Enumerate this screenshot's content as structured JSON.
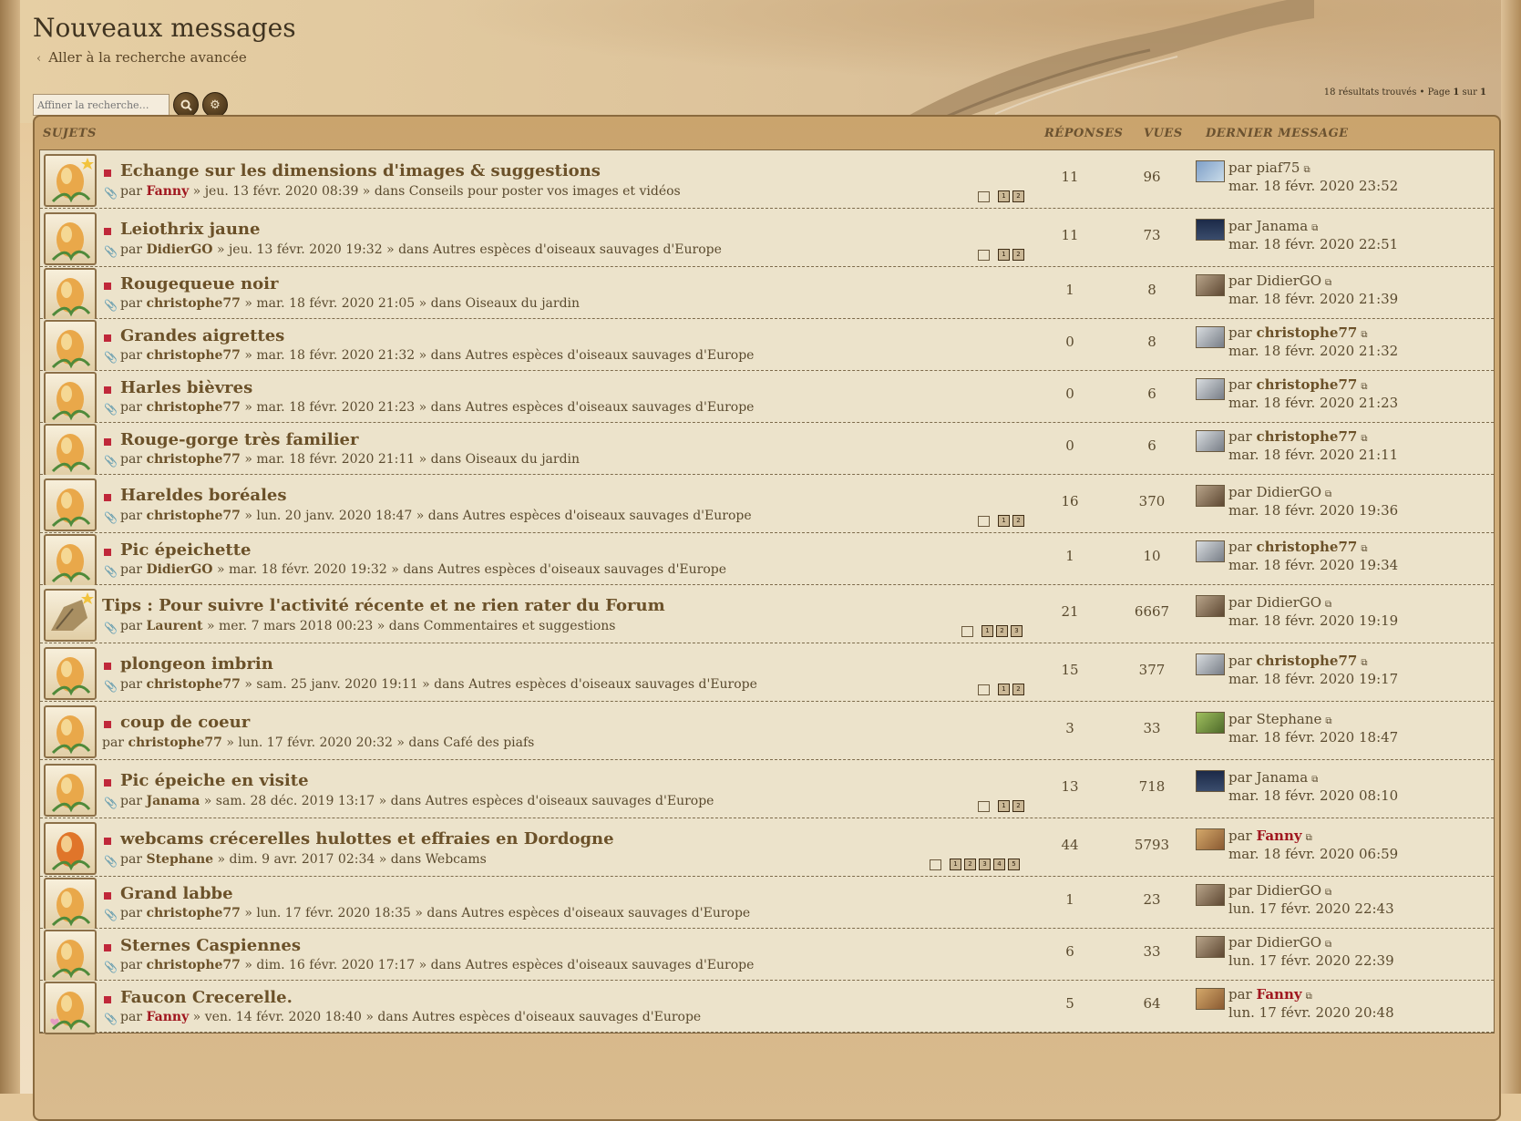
{
  "page": {
    "title": "Nouveaux messages",
    "advanced_search": "Aller à la recherche avancée",
    "search_placeholder": "Affiner la recherche…",
    "results_prefix": "18 résultats trouvés • Page ",
    "results_page": "1",
    "results_mid": " sur ",
    "results_total": "1"
  },
  "columns": {
    "subjects": "SUJETS",
    "replies": "RÉPONSES",
    "views": "VUES",
    "last_post": "DERNIER MESSAGE"
  },
  "colors": {
    "accent": "#6b5129",
    "author_red": "#a0161e",
    "new_marker": "#c0283a"
  },
  "topics": [
    {
      "title": "Echange sur les dimensions d'images & suggestions",
      "by": "par",
      "author": "Fanny",
      "date": "» jeu. 13 févr. 2020 08:39 » dans",
      "forum": "Conseils pour poster vos images et vidéos",
      "pages": [
        "1",
        "2"
      ],
      "replies": "11",
      "views": "96",
      "last_by": "par piaf75",
      "last_date": "mar. 18 févr. 2020 23:52"
    },
    {
      "title": "Leiothrix jaune",
      "by": "par",
      "author": "DidierGO",
      "date": "» jeu. 13 févr. 2020 19:32 » dans",
      "forum": "Autres espèces d'oiseaux sauvages d'Europe",
      "pages": [
        "1",
        "2"
      ],
      "replies": "11",
      "views": "73",
      "last_by": "par Janama",
      "last_date": "mar. 18 févr. 2020 22:51"
    },
    {
      "title": "Rougequeue noir",
      "by": "par",
      "author": "christophe77",
      "date": "» mar. 18 févr. 2020 21:05 » dans",
      "forum": "Oiseaux du jardin",
      "pages": [],
      "replies": "1",
      "views": "8",
      "last_by": "par DidierGO",
      "last_date": "mar. 18 févr. 2020 21:39"
    },
    {
      "title": "Grandes aigrettes",
      "by": "par",
      "author": "christophe77",
      "date": "» mar. 18 févr. 2020 21:32 » dans",
      "forum": "Autres espèces d'oiseaux sauvages d'Europe",
      "pages": [],
      "replies": "0",
      "views": "8",
      "last_by": "par",
      "last_by_user": "christophe77",
      "last_date": "mar. 18 févr. 2020 21:32"
    },
    {
      "title": "Harles bièvres",
      "by": "par",
      "author": "christophe77",
      "date": "» mar. 18 févr. 2020 21:23 » dans",
      "forum": "Autres espèces d'oiseaux sauvages d'Europe",
      "pages": [],
      "replies": "0",
      "views": "6",
      "last_by": "par",
      "last_by_user": "christophe77",
      "last_date": "mar. 18 févr. 2020 21:23"
    },
    {
      "title": "Rouge-gorge très familier",
      "by": "par",
      "author": "christophe77",
      "date": "» mar. 18 févr. 2020 21:11 » dans",
      "forum": "Oiseaux du jardin",
      "pages": [],
      "replies": "0",
      "views": "6",
      "last_by": "par",
      "last_by_user": "christophe77",
      "last_date": "mar. 18 févr. 2020 21:11"
    },
    {
      "title": "Hareldes boréales",
      "by": "par",
      "author": "christophe77",
      "date": "» lun. 20 janv. 2020 18:47 » dans",
      "forum": "Autres espèces d'oiseaux sauvages d'Europe",
      "pages": [
        "1",
        "2"
      ],
      "replies": "16",
      "views": "370",
      "last_by": "par DidierGO",
      "last_date": "mar. 18 févr. 2020 19:36"
    },
    {
      "title": "Pic épeichette",
      "by": "par",
      "author": "DidierGO",
      "date": "» mar. 18 févr. 2020 19:32 » dans",
      "forum": "Autres espèces d'oiseaux sauvages d'Europe",
      "pages": [],
      "replies": "1",
      "views": "10",
      "last_by": "par",
      "last_by_user": "christophe77",
      "last_date": "mar. 18 févr. 2020 19:34"
    },
    {
      "title": "Tips : Pour suivre l'activité récente et ne rien rater du Forum",
      "by": "par",
      "author": "Laurent",
      "date": "» mer. 7 mars 2018 00:23 » dans",
      "forum": "Commentaires et suggestions",
      "pages": [
        "1",
        "2",
        "3"
      ],
      "replies": "21",
      "views": "6667",
      "last_by": "par DidierGO",
      "last_date": "mar. 18 févr. 2020 19:19"
    },
    {
      "title": "plongeon imbrin",
      "by": "par",
      "author": "christophe77",
      "date": "» sam. 25 janv. 2020 19:11 » dans",
      "forum": "Autres espèces d'oiseaux sauvages d'Europe",
      "pages": [
        "1",
        "2"
      ],
      "replies": "15",
      "views": "377",
      "last_by": "par",
      "last_by_user": "christophe77",
      "last_date": "mar. 18 févr. 2020 19:17"
    },
    {
      "title": "coup de coeur",
      "by": "par",
      "author": "christophe77",
      "date": "» lun. 17 févr. 2020 20:32 » dans",
      "forum": "Café des piafs",
      "pages": [],
      "replies": "3",
      "views": "33",
      "last_by": "par Stephane",
      "last_date": "mar. 18 févr. 2020 18:47"
    },
    {
      "title": "Pic épeiche en visite",
      "by": "par",
      "author": "Janama",
      "date": "» sam. 28 déc. 2019 13:17 » dans",
      "forum": "Autres espèces d'oiseaux sauvages d'Europe",
      "pages": [
        "1",
        "2"
      ],
      "replies": "13",
      "views": "718",
      "last_by": "par Janama",
      "last_date": "mar. 18 févr. 2020 08:10"
    },
    {
      "title": "webcams crécerelles hulottes et effraies en Dordogne",
      "by": "par",
      "author": "Stephane",
      "date": "» dim. 9 avr. 2017 02:34 » dans",
      "forum": "Webcams",
      "pages": [
        "1",
        "2",
        "3",
        "4",
        "5"
      ],
      "replies": "44",
      "views": "5793",
      "last_by": "par",
      "last_by_user": "Fanny",
      "last_date": "mar. 18 févr. 2020 06:59"
    },
    {
      "title": "Grand labbe",
      "by": "par",
      "author": "christophe77",
      "date": "» lun. 17 févr. 2020 18:35 » dans",
      "forum": "Autres espèces d'oiseaux sauvages d'Europe",
      "pages": [],
      "replies": "1",
      "views": "23",
      "last_by": "par DidierGO",
      "last_date": "lun. 17 févr. 2020 22:43"
    },
    {
      "title": "Sternes Caspiennes",
      "by": "par",
      "author": "christophe77",
      "date": "» dim. 16 févr. 2020 17:17 » dans",
      "forum": "Autres espèces d'oiseaux sauvages d'Europe",
      "pages": [],
      "replies": "6",
      "views": "33",
      "last_by": "par DidierGO",
      "last_date": "lun. 17 févr. 2020 22:39"
    },
    {
      "title": "Faucon Crecerelle.",
      "by": "par",
      "author": "Fanny",
      "date": "» ven. 14 févr. 2020 18:40 » dans",
      "forum": "Autres espèces d'oiseaux sauvages d'Europe",
      "pages": [],
      "replies": "5",
      "views": "64",
      "last_by": "par",
      "last_by_user": "Fanny",
      "last_date": "lun. 17 févr. 2020 20:48"
    }
  ]
}
